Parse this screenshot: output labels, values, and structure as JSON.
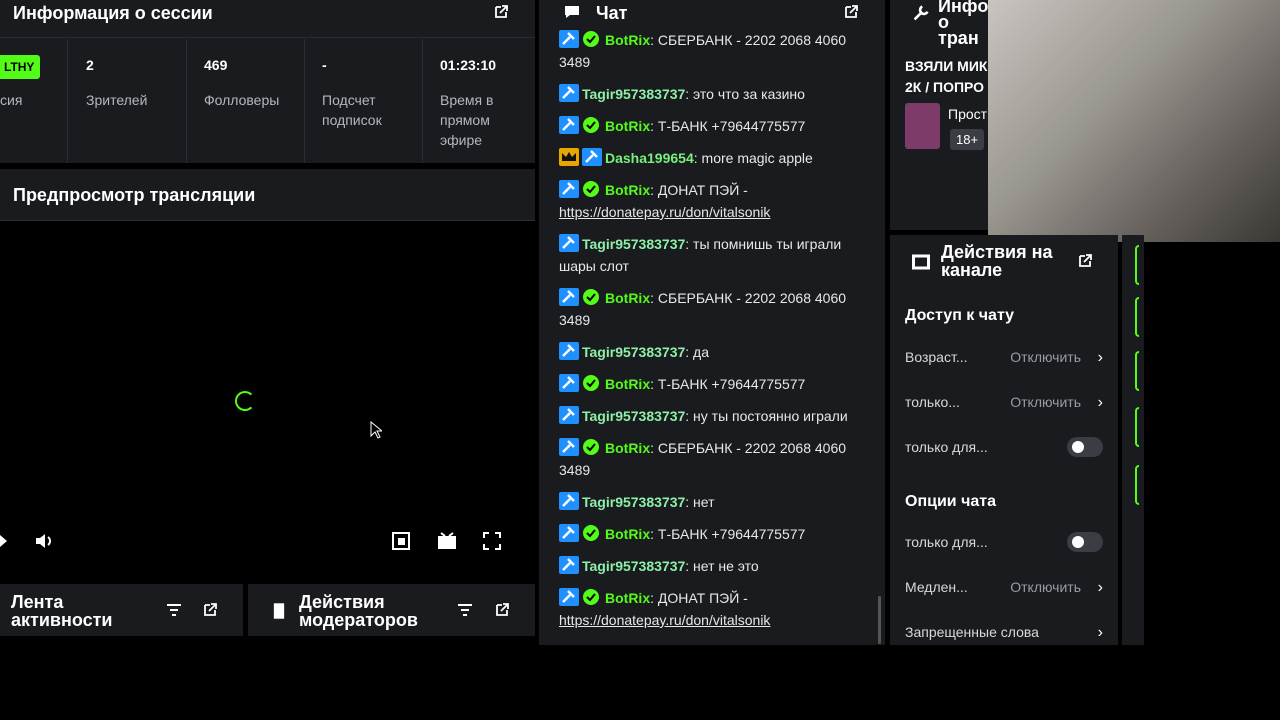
{
  "session": {
    "title": "Информация о сессии",
    "badge": "LTHY",
    "badge_sub": "сия",
    "stats": [
      {
        "value": "2",
        "label": "Зрителей"
      },
      {
        "value": "469",
        "label": "Фолловеры"
      },
      {
        "value": "-",
        "label": "Подсчет подписок"
      },
      {
        "value": "01:23:10",
        "label": "Время в прямом эфире"
      }
    ]
  },
  "preview": {
    "title": "Предпросмотр трансляции"
  },
  "activity": {
    "title": "Лента активности"
  },
  "modactions": {
    "title": "Действия модераторов"
  },
  "chat": {
    "title": "Чат",
    "messages": [
      {
        "user": "BotRix",
        "kind": "bot",
        "text": "СБЕРБАНК - 2202 2068 4060 3489"
      },
      {
        "user": "Tagir957383737",
        "kind": "tag",
        "text": "это что за казино"
      },
      {
        "user": "BotRix",
        "kind": "bot",
        "text": "Т-БАНК +79644775577"
      },
      {
        "user": "Dasha199654",
        "kind": "dash",
        "text": "more magic apple"
      },
      {
        "user": "BotRix",
        "kind": "bot",
        "text": "ДОНАТ ПЭЙ - ",
        "link": "https://donatepay.ru/don/vitalsonik"
      },
      {
        "user": "Tagir957383737",
        "kind": "tag",
        "text": "ты помнишь ты играли шары слот"
      },
      {
        "user": "BotRix",
        "kind": "bot",
        "text": "СБЕРБАНК - 2202 2068 4060 3489"
      },
      {
        "user": "Tagir957383737",
        "kind": "tag",
        "text": "да"
      },
      {
        "user": "BotRix",
        "kind": "bot",
        "text": "Т-БАНК +79644775577"
      },
      {
        "user": "Tagir957383737",
        "kind": "tag",
        "text": "ну ты постоянно играли"
      },
      {
        "user": "BotRix",
        "kind": "bot",
        "text": "СБЕРБАНК - 2202 2068 4060 3489"
      },
      {
        "user": "Tagir957383737",
        "kind": "tag",
        "text": "нет"
      },
      {
        "user": "BotRix",
        "kind": "bot",
        "text": "Т-БАНК +79644775577"
      },
      {
        "user": "Tagir957383737",
        "kind": "tag",
        "text": "нет не это"
      },
      {
        "user": "BotRix",
        "kind": "bot",
        "text": "ДОНАТ ПЭЙ - ",
        "link": "https://donatepay.ru/don/vitalsonik"
      }
    ]
  },
  "info2": {
    "title_1": "Инфо",
    "title_2": "о тран",
    "promo_1": "ВЗЯЛИ МИК",
    "promo_2": "2К / ПОПРО",
    "category": "Прост",
    "age": "18+"
  },
  "actions": {
    "title_1": "Действия на",
    "title_2": "канале",
    "chat_access": "Доступ к чату",
    "rows1": [
      {
        "label": "Возраст...",
        "value": "Отключить"
      },
      {
        "label": "только...",
        "value": "Отключить"
      }
    ],
    "toggle_row_1": "только для...",
    "chat_options": "Опции чата",
    "toggle_row_2": "только для...",
    "slow_label": "Медлен...",
    "slow_value": "Отключить",
    "banned_words": "Запрещенные слова"
  },
  "colors": {
    "accent": "#53fc18",
    "panel": "#191b1f",
    "bg": "#000000"
  }
}
